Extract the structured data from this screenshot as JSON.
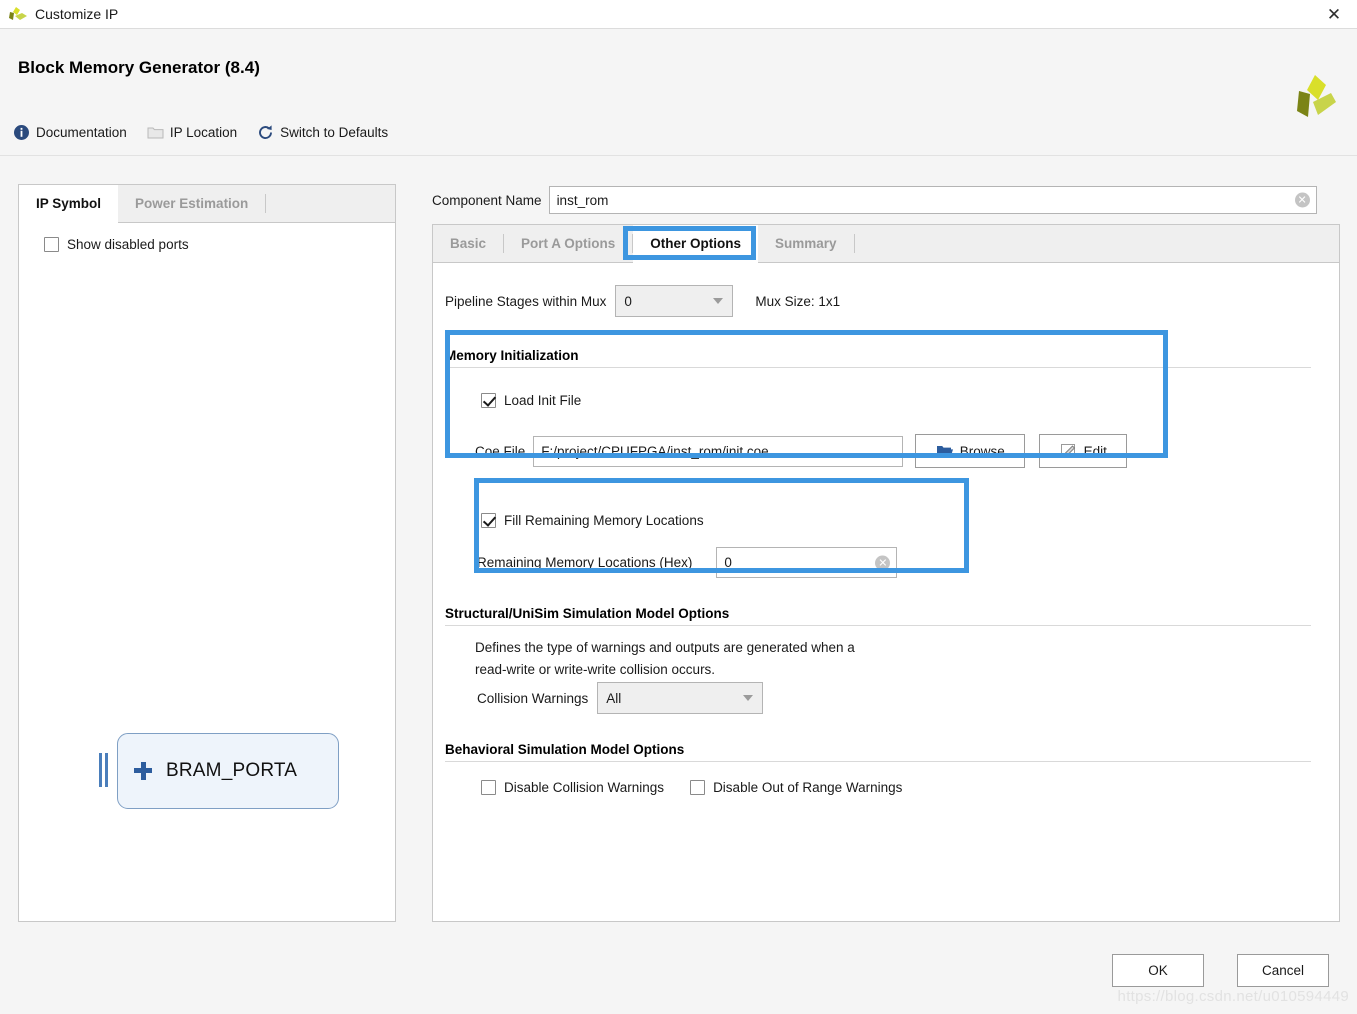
{
  "window": {
    "title": "Customize IP",
    "close_label": "✕",
    "app_icon": "xilinx-logo-icon"
  },
  "header": {
    "title": "Block Memory Generator (8.4)",
    "logo_icon": "xilinx-logo-icon",
    "toolbar": [
      {
        "label": "Documentation",
        "icon": "info-icon"
      },
      {
        "label": "IP Location",
        "icon": "folder-icon"
      },
      {
        "label": "Switch to Defaults",
        "icon": "refresh-icon"
      }
    ]
  },
  "left_panel": {
    "tabs": [
      {
        "label": "IP Symbol",
        "active": true
      },
      {
        "label": "Power Estimation",
        "active": false
      }
    ],
    "show_disabled_ports": {
      "label": "Show disabled ports",
      "checked": false
    },
    "symbol": {
      "block_label": "BRAM_PORTA",
      "expander": "+"
    }
  },
  "component_name": {
    "label": "Component Name",
    "value": "inst_rom",
    "placeholder": "",
    "clear_icon": "✕"
  },
  "right_panel": {
    "tabs": [
      {
        "label": "Basic",
        "active": false
      },
      {
        "label": "Port A Options",
        "active": false
      },
      {
        "label": "Other Options",
        "active": true
      },
      {
        "label": "Summary",
        "active": false
      }
    ],
    "pipeline": {
      "label": "Pipeline Stages within Mux",
      "value": "0",
      "mux_size": "Mux Size: 1x1"
    },
    "memory_initialization": {
      "heading": "Memory Initialization",
      "load_init_file": {
        "label": "Load Init File",
        "checked": true
      },
      "coe_file": {
        "label": "Coe File",
        "value": "F:/project/CPUFPGA/inst_rom/init.coe",
        "placeholder": ""
      },
      "browse_button": {
        "label": "Browse",
        "icon": "folder-open-icon"
      },
      "edit_button": {
        "label": "Edit",
        "icon": "pencil-icon"
      }
    },
    "fill_remaining": {
      "checkbox": {
        "label": "Fill Remaining Memory Locations",
        "checked": true
      },
      "hex_label": "Remaining Memory Locations (Hex)",
      "hex_value": "0",
      "clear_icon": "✕"
    },
    "structural": {
      "heading": "Structural/UniSim Simulation Model Options",
      "description_line1": "Defines the type of warnings and outputs are generated when a",
      "description_line2": "read-write or write-write collision occurs.",
      "collision_warnings": {
        "label": "Collision Warnings",
        "value": "All"
      }
    },
    "behavioral": {
      "heading": "Behavioral Simulation Model Options",
      "options": [
        {
          "label": "Disable Collision Warnings",
          "checked": false
        },
        {
          "label": "Disable Out of Range Warnings",
          "checked": false
        }
      ]
    }
  },
  "footer": {
    "ok_label": "OK",
    "cancel_label": "Cancel"
  },
  "watermark": "https://blog.csdn.net/u010594449",
  "colors": {
    "annotation": "#3d96e0",
    "accent_blue": "#2d5d9e",
    "panel_bg": "#f5f5f5"
  }
}
